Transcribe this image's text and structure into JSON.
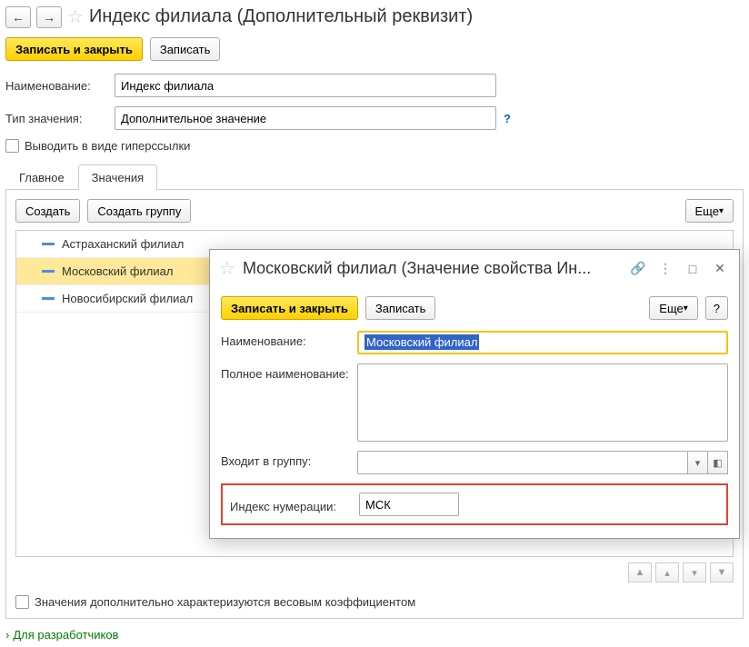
{
  "header": {
    "title": "Индекс филиала (Дополнительный реквизит)"
  },
  "toolbar": {
    "save_close": "Записать и закрыть",
    "save": "Записать"
  },
  "form": {
    "name_label": "Наименование:",
    "name_value": "Индекс филиала",
    "type_label": "Тип значения:",
    "type_value": "Дополнительное значение",
    "hyperlink_label": "Выводить в виде гиперссылки"
  },
  "tabs": {
    "main": "Главное",
    "values": "Значения"
  },
  "values_tab": {
    "create": "Создать",
    "create_group": "Создать группу",
    "more": "Еще",
    "rows": [
      {
        "label": "Астраханский филиал"
      },
      {
        "label": "Московский филиал"
      },
      {
        "label": "Новосибирский филиал"
      }
    ],
    "weight_label": "Значения дополнительно характеризуются весовым коэффициентом"
  },
  "dev_link": "Для разработчиков",
  "dialog": {
    "title": "Московский филиал (Значение свойства Ин...",
    "save_close": "Записать и закрыть",
    "save": "Записать",
    "more": "Еще",
    "help": "?",
    "name_label": "Наименование:",
    "name_value": "Московский филиал",
    "fullname_label": "Полное наименование:",
    "fullname_value": "",
    "group_label": "Входит в группу:",
    "index_label": "Индекс нумерации:",
    "index_value": "МСК"
  }
}
